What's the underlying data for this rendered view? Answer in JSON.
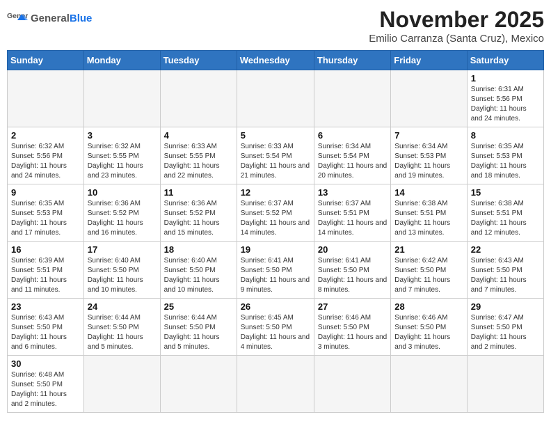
{
  "header": {
    "logo_general": "General",
    "logo_blue": "Blue",
    "month": "November 2025",
    "subtitle": "Emilio Carranza (Santa Cruz), Mexico"
  },
  "weekdays": [
    "Sunday",
    "Monday",
    "Tuesday",
    "Wednesday",
    "Thursday",
    "Friday",
    "Saturday"
  ],
  "weeks": [
    [
      {
        "day": "",
        "info": ""
      },
      {
        "day": "",
        "info": ""
      },
      {
        "day": "",
        "info": ""
      },
      {
        "day": "",
        "info": ""
      },
      {
        "day": "",
        "info": ""
      },
      {
        "day": "",
        "info": ""
      },
      {
        "day": "1",
        "info": "Sunrise: 6:31 AM\nSunset: 5:56 PM\nDaylight: 11 hours and 24 minutes."
      }
    ],
    [
      {
        "day": "2",
        "info": "Sunrise: 6:32 AM\nSunset: 5:56 PM\nDaylight: 11 hours and 24 minutes."
      },
      {
        "day": "3",
        "info": "Sunrise: 6:32 AM\nSunset: 5:55 PM\nDaylight: 11 hours and 23 minutes."
      },
      {
        "day": "4",
        "info": "Sunrise: 6:33 AM\nSunset: 5:55 PM\nDaylight: 11 hours and 22 minutes."
      },
      {
        "day": "5",
        "info": "Sunrise: 6:33 AM\nSunset: 5:54 PM\nDaylight: 11 hours and 21 minutes."
      },
      {
        "day": "6",
        "info": "Sunrise: 6:34 AM\nSunset: 5:54 PM\nDaylight: 11 hours and 20 minutes."
      },
      {
        "day": "7",
        "info": "Sunrise: 6:34 AM\nSunset: 5:53 PM\nDaylight: 11 hours and 19 minutes."
      },
      {
        "day": "8",
        "info": "Sunrise: 6:35 AM\nSunset: 5:53 PM\nDaylight: 11 hours and 18 minutes."
      }
    ],
    [
      {
        "day": "9",
        "info": "Sunrise: 6:35 AM\nSunset: 5:53 PM\nDaylight: 11 hours and 17 minutes."
      },
      {
        "day": "10",
        "info": "Sunrise: 6:36 AM\nSunset: 5:52 PM\nDaylight: 11 hours and 16 minutes."
      },
      {
        "day": "11",
        "info": "Sunrise: 6:36 AM\nSunset: 5:52 PM\nDaylight: 11 hours and 15 minutes."
      },
      {
        "day": "12",
        "info": "Sunrise: 6:37 AM\nSunset: 5:52 PM\nDaylight: 11 hours and 14 minutes."
      },
      {
        "day": "13",
        "info": "Sunrise: 6:37 AM\nSunset: 5:51 PM\nDaylight: 11 hours and 14 minutes."
      },
      {
        "day": "14",
        "info": "Sunrise: 6:38 AM\nSunset: 5:51 PM\nDaylight: 11 hours and 13 minutes."
      },
      {
        "day": "15",
        "info": "Sunrise: 6:38 AM\nSunset: 5:51 PM\nDaylight: 11 hours and 12 minutes."
      }
    ],
    [
      {
        "day": "16",
        "info": "Sunrise: 6:39 AM\nSunset: 5:51 PM\nDaylight: 11 hours and 11 minutes."
      },
      {
        "day": "17",
        "info": "Sunrise: 6:40 AM\nSunset: 5:50 PM\nDaylight: 11 hours and 10 minutes."
      },
      {
        "day": "18",
        "info": "Sunrise: 6:40 AM\nSunset: 5:50 PM\nDaylight: 11 hours and 10 minutes."
      },
      {
        "day": "19",
        "info": "Sunrise: 6:41 AM\nSunset: 5:50 PM\nDaylight: 11 hours and 9 minutes."
      },
      {
        "day": "20",
        "info": "Sunrise: 6:41 AM\nSunset: 5:50 PM\nDaylight: 11 hours and 8 minutes."
      },
      {
        "day": "21",
        "info": "Sunrise: 6:42 AM\nSunset: 5:50 PM\nDaylight: 11 hours and 7 minutes."
      },
      {
        "day": "22",
        "info": "Sunrise: 6:43 AM\nSunset: 5:50 PM\nDaylight: 11 hours and 7 minutes."
      }
    ],
    [
      {
        "day": "23",
        "info": "Sunrise: 6:43 AM\nSunset: 5:50 PM\nDaylight: 11 hours and 6 minutes."
      },
      {
        "day": "24",
        "info": "Sunrise: 6:44 AM\nSunset: 5:50 PM\nDaylight: 11 hours and 5 minutes."
      },
      {
        "day": "25",
        "info": "Sunrise: 6:44 AM\nSunset: 5:50 PM\nDaylight: 11 hours and 5 minutes."
      },
      {
        "day": "26",
        "info": "Sunrise: 6:45 AM\nSunset: 5:50 PM\nDaylight: 11 hours and 4 minutes."
      },
      {
        "day": "27",
        "info": "Sunrise: 6:46 AM\nSunset: 5:50 PM\nDaylight: 11 hours and 3 minutes."
      },
      {
        "day": "28",
        "info": "Sunrise: 6:46 AM\nSunset: 5:50 PM\nDaylight: 11 hours and 3 minutes."
      },
      {
        "day": "29",
        "info": "Sunrise: 6:47 AM\nSunset: 5:50 PM\nDaylight: 11 hours and 2 minutes."
      }
    ],
    [
      {
        "day": "30",
        "info": "Sunrise: 6:48 AM\nSunset: 5:50 PM\nDaylight: 11 hours and 2 minutes."
      },
      {
        "day": "",
        "info": ""
      },
      {
        "day": "",
        "info": ""
      },
      {
        "day": "",
        "info": ""
      },
      {
        "day": "",
        "info": ""
      },
      {
        "day": "",
        "info": ""
      },
      {
        "day": "",
        "info": ""
      }
    ]
  ]
}
